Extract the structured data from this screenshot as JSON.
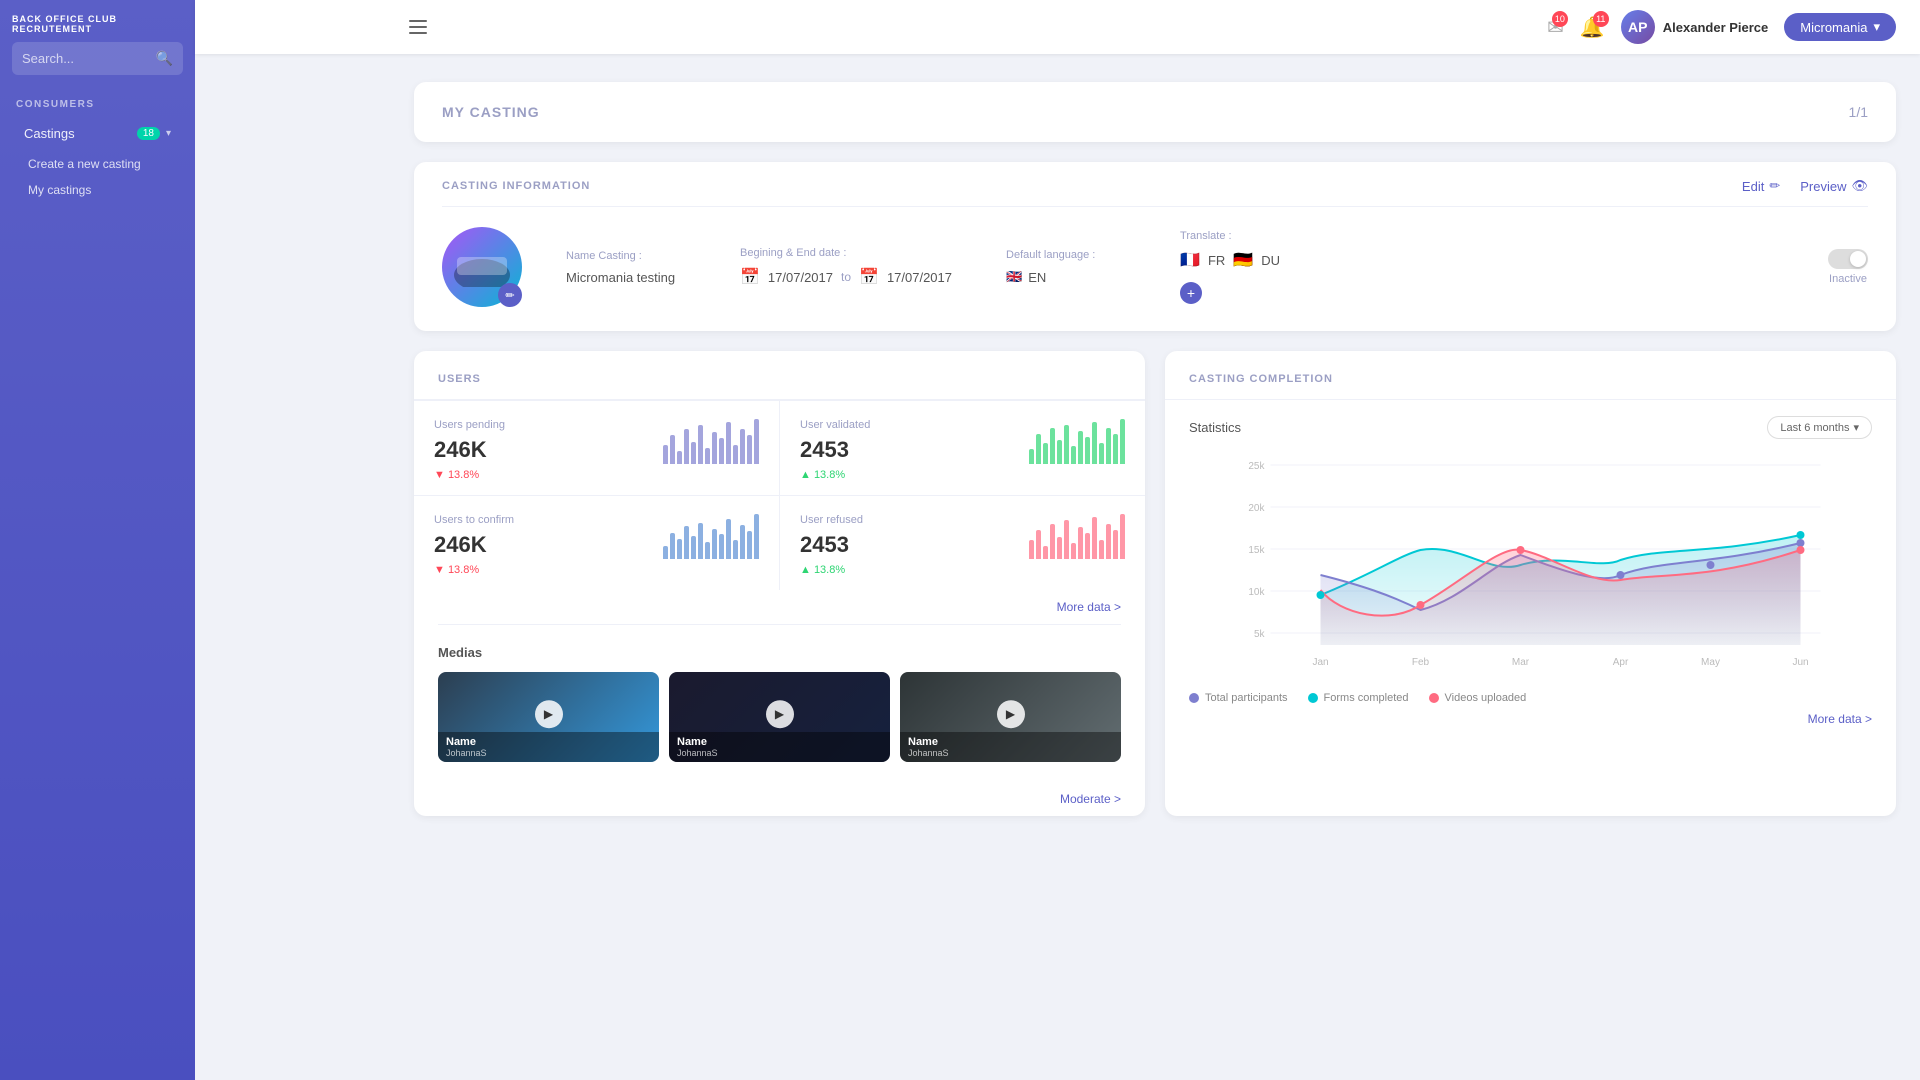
{
  "app": {
    "title": "BACK OFFICE CLUB RECRUTEMENT"
  },
  "topnav": {
    "mail_count": "10",
    "notif_count": "11",
    "username": "Alexander Pierce",
    "dropdown_label": "Micromania",
    "hamburger_icon": "☰"
  },
  "sidebar": {
    "search_placeholder": "Search...",
    "section_label": "CONSUMERS",
    "menu": {
      "castings_label": "Castings",
      "castings_badge": "18",
      "sub_items": [
        {
          "label": "Create a new casting"
        },
        {
          "label": "My castings"
        }
      ]
    }
  },
  "casting_header": {
    "title": "MY CASTING",
    "pagination": "1/1"
  },
  "casting_info": {
    "section_label": "CASTING INFORMATION",
    "edit_label": "Edit",
    "preview_label": "Preview",
    "name_label": "Name Casting :",
    "name_value": "Micromania testing",
    "date_label": "Begining & End date :",
    "date_start": "17/07/2017",
    "date_to": "to",
    "date_end": "17/07/2017",
    "default_lang_label": "Default language :",
    "default_lang_value": "EN",
    "translate_label": "Translate :",
    "translate_fr": "FR",
    "translate_du": "DU",
    "toggle_status": "Inactive"
  },
  "users_section": {
    "title": "USERS",
    "stats": [
      {
        "label": "Users pending",
        "value": "246K",
        "change": "▼ 13.8%",
        "type": "negative",
        "color": "#5b5fc7"
      },
      {
        "label": "User validated",
        "value": "2453",
        "change": "▲ 13.8%",
        "type": "positive",
        "color": "#2ed573"
      },
      {
        "label": "Users to confirm",
        "value": "246K",
        "change": "▼ 13.8%",
        "type": "negative",
        "color": "#5b5fc7"
      },
      {
        "label": "User refused",
        "value": "2453",
        "change": "▲ 13.8%",
        "type": "positive",
        "color": "#ff4757"
      }
    ],
    "more_data": "More data >",
    "medias_title": "Medias",
    "moderate": "Moderate >",
    "medias": [
      {
        "name": "Name",
        "user": "JohannaS"
      },
      {
        "name": "Name",
        "user": "JohannaS"
      },
      {
        "name": "Name",
        "user": "JohannaS"
      }
    ]
  },
  "chart_section": {
    "title": "CASTING COMPLETION",
    "chart_label": "Statistics",
    "period_label": "Last 6 months",
    "more_data": "More data >",
    "y_labels": [
      "25k",
      "20k",
      "15k",
      "10k",
      "5k"
    ],
    "x_labels": [
      "Jan",
      "Feb",
      "Mar",
      "Apr",
      "May",
      "Jun"
    ],
    "legend": [
      {
        "label": "Total participants",
        "color": "#7e7fcf"
      },
      {
        "label": "Forms completed",
        "color": "#00c8d4"
      },
      {
        "label": "Videos uploaded",
        "color": "#ff6b81"
      }
    ]
  },
  "mini_bars": {
    "purple": [
      30,
      45,
      20,
      55,
      35,
      60,
      25,
      50,
      40,
      65,
      30,
      55,
      45,
      70
    ],
    "green": [
      25,
      50,
      35,
      60,
      40,
      65,
      30,
      55,
      45,
      70,
      35,
      60,
      50,
      75
    ],
    "blue": [
      20,
      40,
      30,
      50,
      35,
      55,
      25,
      45,
      38,
      60,
      28,
      52,
      42,
      68
    ],
    "red": [
      30,
      45,
      20,
      55,
      35,
      60,
      25,
      50,
      40,
      65,
      30,
      55,
      45,
      70
    ]
  }
}
